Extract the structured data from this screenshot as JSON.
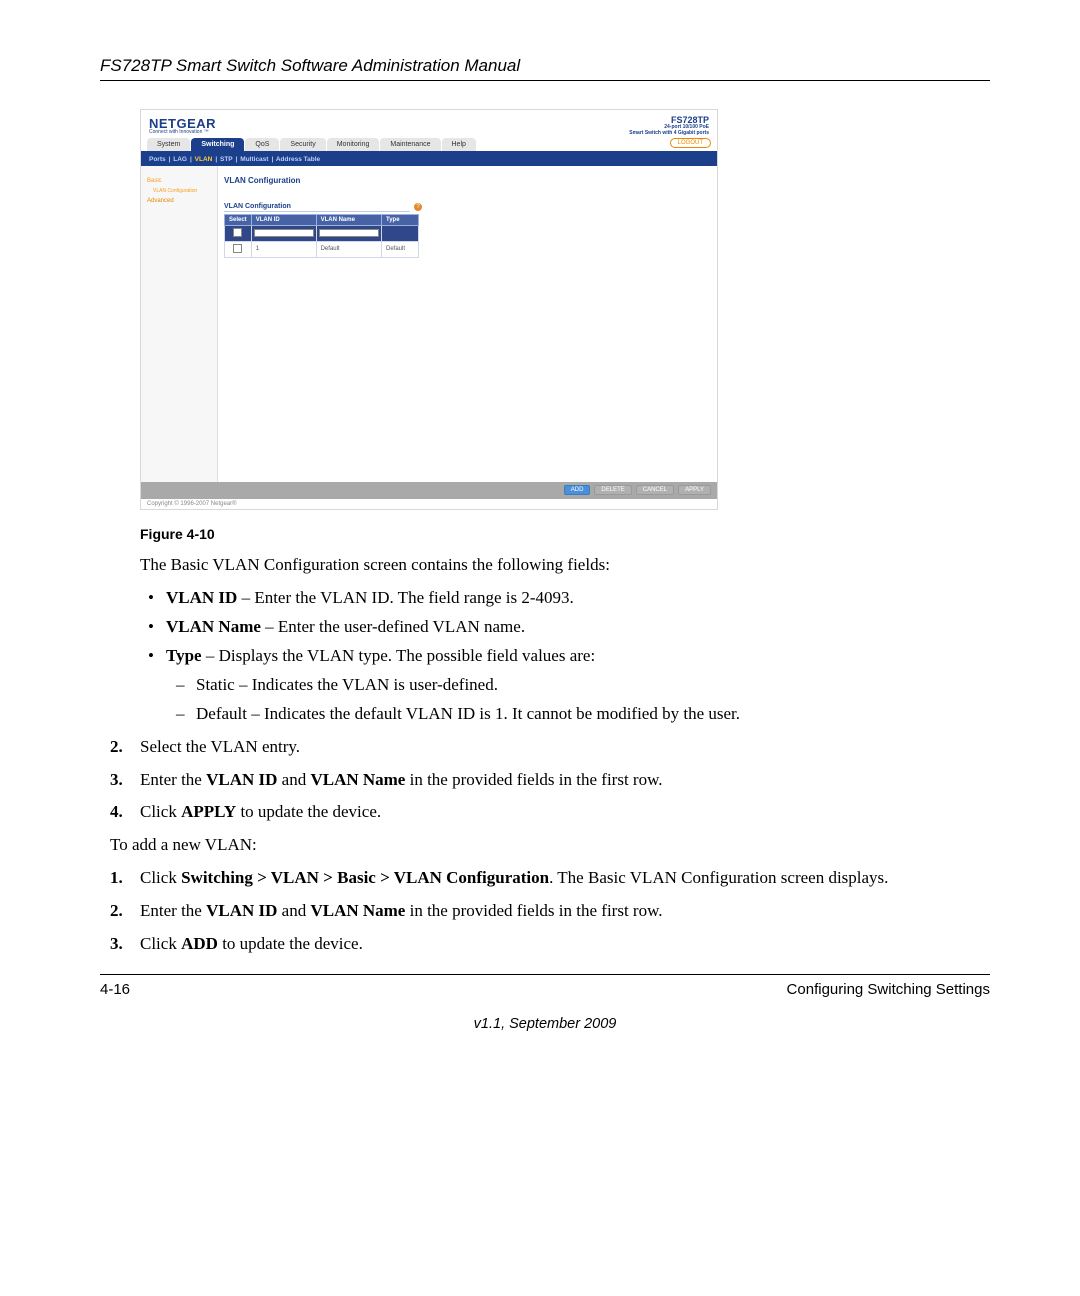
{
  "doc": {
    "header_title": "FS728TP Smart Switch Software Administration Manual",
    "figure_caption": "Figure 4-10",
    "intro": "The Basic VLAN Configuration screen contains the following fields:",
    "bullets": {
      "vlan_id_label": "VLAN ID",
      "vlan_id_desc": " – Enter the VLAN ID. The field range is 2-4093.",
      "vlan_name_label": "VLAN Name",
      "vlan_name_desc": " – Enter the user-defined VLAN name.",
      "type_label": "Type",
      "type_desc": " – Displays the VLAN type. The possible field values are:",
      "sub_static": "Static – Indicates the VLAN is user-defined.",
      "sub_default": "Default – Indicates the default VLAN ID is 1. It cannot be modified by the user."
    },
    "steps_a": {
      "s2": "Select the VLAN entry.",
      "s3_pre": "Enter the ",
      "s3_b1": "VLAN ID",
      "s3_mid": " and ",
      "s3_b2": "VLAN Name",
      "s3_post": " in the provided fields in the first row.",
      "s4_pre": "Click ",
      "s4_b": "APPLY",
      "s4_post": " to update the device."
    },
    "to_add": "To add a new VLAN:",
    "steps_b": {
      "s1_pre": "Click ",
      "s1_b": "Switching > VLAN > Basic > VLAN Configuration",
      "s1_post": ". The Basic VLAN Configuration screen displays.",
      "s2_pre": "Enter the ",
      "s2_b1": "VLAN ID",
      "s2_mid": " and ",
      "s2_b2": "VLAN Name",
      "s2_post": " in the provided fields in the first row.",
      "s3_pre": "Click ",
      "s3_b": "ADD",
      "s3_post": " to update the device."
    },
    "footer_left": "4-16",
    "footer_right": "Configuring Switching Settings",
    "footer_center": "v1.1, September 2009"
  },
  "fig": {
    "brand": "NETGEAR",
    "brand_sub": "Connect with Innovation ™",
    "model": "FS728TP",
    "model_sub1": "24-port 10/100 PoE",
    "model_sub2": "Smart Switch with 4 Gigabit ports",
    "tabs": [
      "System",
      "Switching",
      "QoS",
      "Security",
      "Monitoring",
      "Maintenance",
      "Help"
    ],
    "active_tab_index": 1,
    "logout": "LOGOUT",
    "subnav": [
      "Ports",
      "LAG",
      "VLAN",
      "STP",
      "Multicast",
      "Address Table"
    ],
    "subnav_active_index": 2,
    "leftnav": {
      "basic": "Basic",
      "basic_sub": "VLAN Configuration",
      "advanced": "Advanced"
    },
    "panel_title": "VLAN Configuration",
    "panel_subtitle": "VLAN Configuration",
    "table": {
      "headers": [
        "Select",
        "VLAN ID",
        "VLAN Name",
        "Type"
      ],
      "row": {
        "id": "1",
        "name": "Default",
        "type": "Default"
      }
    },
    "buttons": {
      "add": "ADD",
      "delete": "DELETE",
      "cancel": "CANCEL",
      "apply": "APPLY"
    },
    "copyright": "Copyright © 1996-2007 Netgear®"
  }
}
